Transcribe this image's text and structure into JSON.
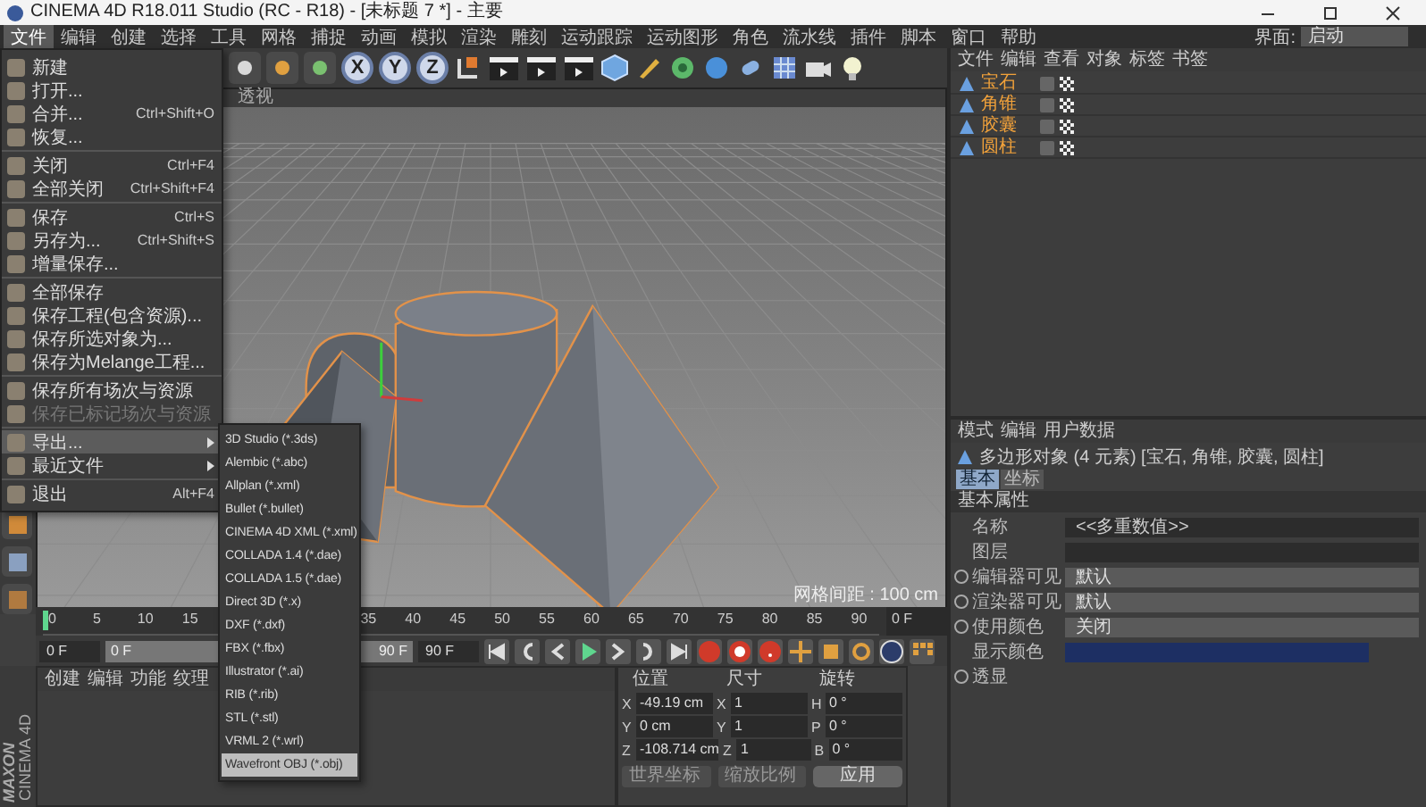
{
  "window": {
    "title": "CINEMA 4D R18.011 Studio (RC - R18) - [未标题 7 *] - 主要"
  },
  "menu_bar": [
    {
      "label": "文件",
      "selected": true
    },
    {
      "label": "编辑",
      "selected": false
    },
    {
      "label": "创建",
      "selected": false
    },
    {
      "label": "选择",
      "selected": false
    },
    {
      "label": "工具",
      "selected": false
    },
    {
      "label": "网格",
      "selected": false
    },
    {
      "label": "捕捉",
      "selected": false
    },
    {
      "label": "动画",
      "selected": false
    },
    {
      "label": "模拟",
      "selected": false
    },
    {
      "label": "渲染",
      "selected": false
    },
    {
      "label": "雕刻",
      "selected": false
    },
    {
      "label": "运动跟踪",
      "selected": false
    },
    {
      "label": "运动图形",
      "selected": false
    },
    {
      "label": "角色",
      "selected": false
    },
    {
      "label": "流水线",
      "selected": false
    },
    {
      "label": "插件",
      "selected": false
    },
    {
      "label": "脚本",
      "selected": false
    },
    {
      "label": "窗口",
      "selected": false
    },
    {
      "label": "帮助",
      "selected": false
    }
  ],
  "layout_selector": {
    "label": "界面:",
    "value": "启动"
  },
  "toolbar": {
    "axis_buttons": [
      "X",
      "Y",
      "Z"
    ]
  },
  "file_menu": {
    "groups": [
      [
        {
          "label": "新建",
          "kind": "item",
          "selected": false,
          "disabled": false
        },
        {
          "label": "打开...",
          "kind": "item",
          "selected": false,
          "disabled": false
        },
        {
          "label": "合并...",
          "shortcut": "Ctrl+Shift+O",
          "kind": "item",
          "selected": false,
          "disabled": false
        },
        {
          "label": "恢复...",
          "kind": "item",
          "selected": false,
          "disabled": false
        }
      ],
      [
        {
          "label": "关闭",
          "shortcut": "Ctrl+F4",
          "kind": "item",
          "selected": false,
          "disabled": false
        },
        {
          "label": "全部关闭",
          "shortcut": "Ctrl+Shift+F4",
          "kind": "item",
          "selected": false,
          "disabled": false
        }
      ],
      [
        {
          "label": "保存",
          "shortcut": "Ctrl+S",
          "kind": "item",
          "selected": false,
          "disabled": false
        },
        {
          "label": "另存为...",
          "shortcut": "Ctrl+Shift+S",
          "kind": "item",
          "selected": false,
          "disabled": false
        },
        {
          "label": "增量保存...",
          "kind": "item",
          "selected": false,
          "disabled": false
        }
      ],
      [
        {
          "label": "全部保存",
          "kind": "item",
          "selected": false,
          "disabled": false
        },
        {
          "label": "保存工程(包含资源)...",
          "kind": "item",
          "selected": false,
          "disabled": false
        },
        {
          "label": "保存所选对象为...",
          "kind": "item",
          "selected": false,
          "disabled": false
        },
        {
          "label": "保存为Melange工程...",
          "kind": "item",
          "selected": false,
          "disabled": false
        }
      ],
      [
        {
          "label": "保存所有场次与资源",
          "kind": "item",
          "selected": false,
          "disabled": false
        },
        {
          "label": "保存已标记场次与资源",
          "kind": "item",
          "selected": false,
          "disabled": true
        }
      ],
      [
        {
          "label": "导出...",
          "kind": "submenu",
          "selected": true,
          "disabled": false
        },
        {
          "label": "最近文件",
          "kind": "submenu",
          "selected": false,
          "disabled": false
        }
      ],
      [
        {
          "label": "退出",
          "shortcut": "Alt+F4",
          "kind": "item",
          "selected": false,
          "disabled": false
        }
      ]
    ]
  },
  "export_submenu": [
    {
      "label": "3D Studio (*.3ds)",
      "selected": false
    },
    {
      "label": "Alembic (*.abc)",
      "selected": false
    },
    {
      "label": "Allplan (*.xml)",
      "selected": false
    },
    {
      "label": "Bullet (*.bullet)",
      "selected": false
    },
    {
      "label": "CINEMA 4D XML (*.xml)",
      "selected": false
    },
    {
      "label": "COLLADA 1.4 (*.dae)",
      "selected": false
    },
    {
      "label": "COLLADA 1.5 (*.dae)",
      "selected": false
    },
    {
      "label": "Direct 3D (*.x)",
      "selected": false
    },
    {
      "label": "DXF (*.dxf)",
      "selected": false
    },
    {
      "label": "FBX (*.fbx)",
      "selected": false
    },
    {
      "label": "Illustrator (*.ai)",
      "selected": false
    },
    {
      "label": "RIB (*.rib)",
      "selected": false
    },
    {
      "label": "STL (*.stl)",
      "selected": false
    },
    {
      "label": "VRML 2 (*.wrl)",
      "selected": false
    },
    {
      "label": "Wavefront OBJ (*.obj)",
      "selected": true
    }
  ],
  "viewport": {
    "label": "透视",
    "grid_spacing": "网格间距 : 100 cm"
  },
  "timeline": {
    "ticks": [
      "0",
      "5",
      "10",
      "15",
      "35",
      "40",
      "45",
      "50",
      "55",
      "60",
      "65",
      "70",
      "75",
      "80",
      "85",
      "90"
    ],
    "level": 0,
    "frame": "0 F"
  },
  "playback": {
    "start": "0 F",
    "range_start": "0 F",
    "range_end": "90 F",
    "end": "90 F"
  },
  "material_manager": {
    "menu": [
      "创建",
      "编辑",
      "功能",
      "纹理"
    ]
  },
  "coordinates": {
    "headers": [
      "位置",
      "尺寸",
      "旋转"
    ],
    "rows": [
      {
        "axes": [
          "X",
          "X",
          "H"
        ],
        "values": [
          "-49.19 cm",
          "1",
          "0 °"
        ]
      },
      {
        "axes": [
          "Y",
          "Y",
          "P"
        ],
        "values": [
          "0 cm",
          "1",
          "0 °"
        ]
      },
      {
        "axes": [
          "Z",
          "Z",
          "B"
        ],
        "values": [
          "-108.714 cm",
          "1",
          "0 °"
        ]
      }
    ],
    "mode": "世界坐标",
    "scale_mode": "缩放比例",
    "apply": "应用"
  },
  "object_manager": {
    "menu": [
      "文件",
      "编辑",
      "查看",
      "对象",
      "标签",
      "书签"
    ],
    "objects": [
      {
        "name": "宝石",
        "selected": true
      },
      {
        "name": "角锥",
        "selected": true
      },
      {
        "name": "胶囊",
        "selected": true
      },
      {
        "name": "圆柱",
        "selected": true
      }
    ]
  },
  "attributes": {
    "menu": [
      "模式",
      "编辑",
      "用户数据"
    ],
    "title": "多边形对象 (4 元素) [宝石, 角锥, 胶囊, 圆柱]",
    "tabs": [
      {
        "label": "基本",
        "selected": true
      },
      {
        "label": "坐标",
        "selected": false
      }
    ],
    "section": "基本属性",
    "properties": [
      {
        "kind": "text",
        "label": "名称",
        "value": "<<多重数值>>"
      },
      {
        "kind": "field",
        "label": "图层"
      },
      {
        "kind": "dropdown",
        "label": "编辑器可见",
        "value": "默认"
      },
      {
        "kind": "dropdown",
        "label": "渲染器可见",
        "value": "默认"
      },
      {
        "kind": "dropdown",
        "label": "使用颜色",
        "value": "关闭"
      },
      {
        "kind": "swatch",
        "label": "显示颜色"
      },
      {
        "kind": "toggle",
        "label": "透显"
      }
    ]
  },
  "logo": {
    "brand": "MAXON",
    "product": "CINEMA 4D"
  }
}
